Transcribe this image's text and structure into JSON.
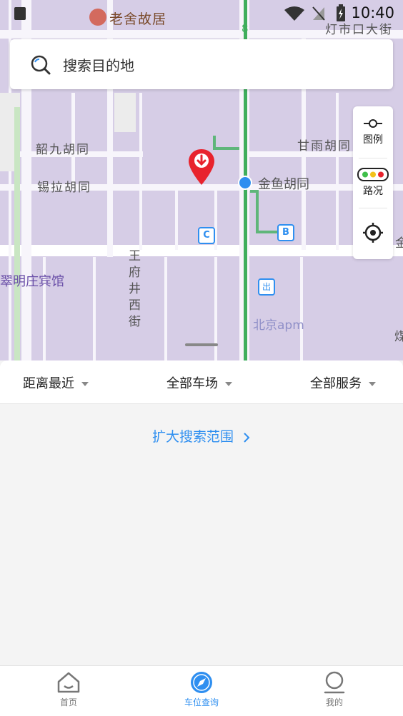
{
  "status": {
    "time": "10:40"
  },
  "map": {
    "poi_top": "老舍故居",
    "labels": {
      "dengshikou": "灯市口大街",
      "shaojiu": "韶九胡同",
      "xila": "锡拉胡同",
      "ganyu": "甘雨胡同",
      "jinyu": "金鱼胡同",
      "wangfujing": "王府井西街",
      "cuiming": "翠明庄宾馆",
      "apm": "北京apm",
      "jin": "金",
      "mei": "煤",
      "line_no": "8"
    },
    "badges": {
      "c": "C",
      "b": "B",
      "exit": "出"
    }
  },
  "search": {
    "placeholder": "搜索目的地"
  },
  "controls": {
    "legend": "图例",
    "traffic": "路况"
  },
  "filters": {
    "distance": "距离最近",
    "lots": "全部车场",
    "services": "全部服务"
  },
  "expand_link": "扩大搜索范围",
  "tabs": {
    "home": "首页",
    "parking": "车位查询",
    "mine": "我的"
  },
  "colors": {
    "accent": "#2f8ff0",
    "marker": "#e8232d",
    "map_block": "#d6cde6",
    "road_green": "#3fae5c"
  }
}
